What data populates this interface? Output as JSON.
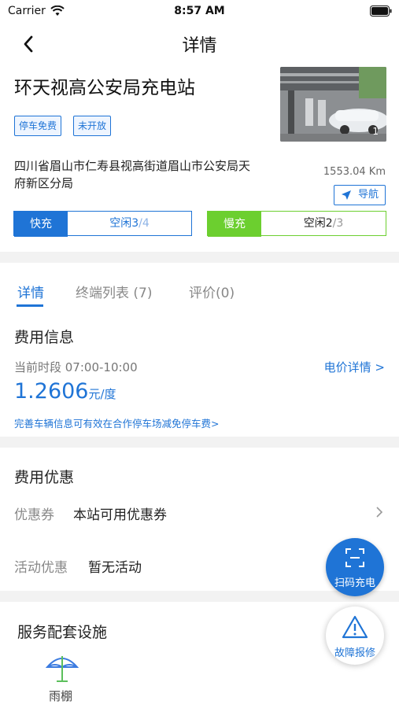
{
  "status_bar": {
    "carrier": "Carrier",
    "time": "8:57 AM"
  },
  "nav": {
    "title": "详情"
  },
  "station": {
    "name": "环天视高公安局充电站",
    "tags": [
      "停车免费",
      "未开放"
    ],
    "photo_counter": "1",
    "address": "四川省眉山市仁寿县视高街道眉山市公安局天府新区分局",
    "distance": "1553.04 Km",
    "navigate_label": "导航"
  },
  "fast": {
    "label": "快充",
    "idle_label": "空闲",
    "available": "3",
    "total": "/4",
    "color": "#1f74d6"
  },
  "slow": {
    "label": "慢充",
    "idle_label": "空闲",
    "available": "2",
    "total": "/3",
    "color": "#6ccf2f"
  },
  "tabs": [
    {
      "label": "详情",
      "active": true
    },
    {
      "label": "终端列表 (7)",
      "active": false
    },
    {
      "label": "评价(0)",
      "active": false
    }
  ],
  "fee": {
    "title": "费用信息",
    "period": "当前时段 07:00-10:00",
    "price_detail_link": "电价详情 >",
    "price": "1.2606",
    "unit": "元/度",
    "promo_link": "完善车辆信息可有效在合作停车场减免停车费>"
  },
  "discount": {
    "title": "费用优惠",
    "coupon_label": "优惠券",
    "coupon_value": "本站可用优惠券",
    "activity_label": "活动优惠",
    "activity_value": "暂无活动"
  },
  "facilities": {
    "title": "服务配套设施",
    "items": [
      {
        "label": "雨棚",
        "icon": "umbrella-icon"
      }
    ]
  },
  "fab_scan": {
    "label": "扫码充电"
  },
  "fab_report": {
    "label": "故障报修"
  }
}
